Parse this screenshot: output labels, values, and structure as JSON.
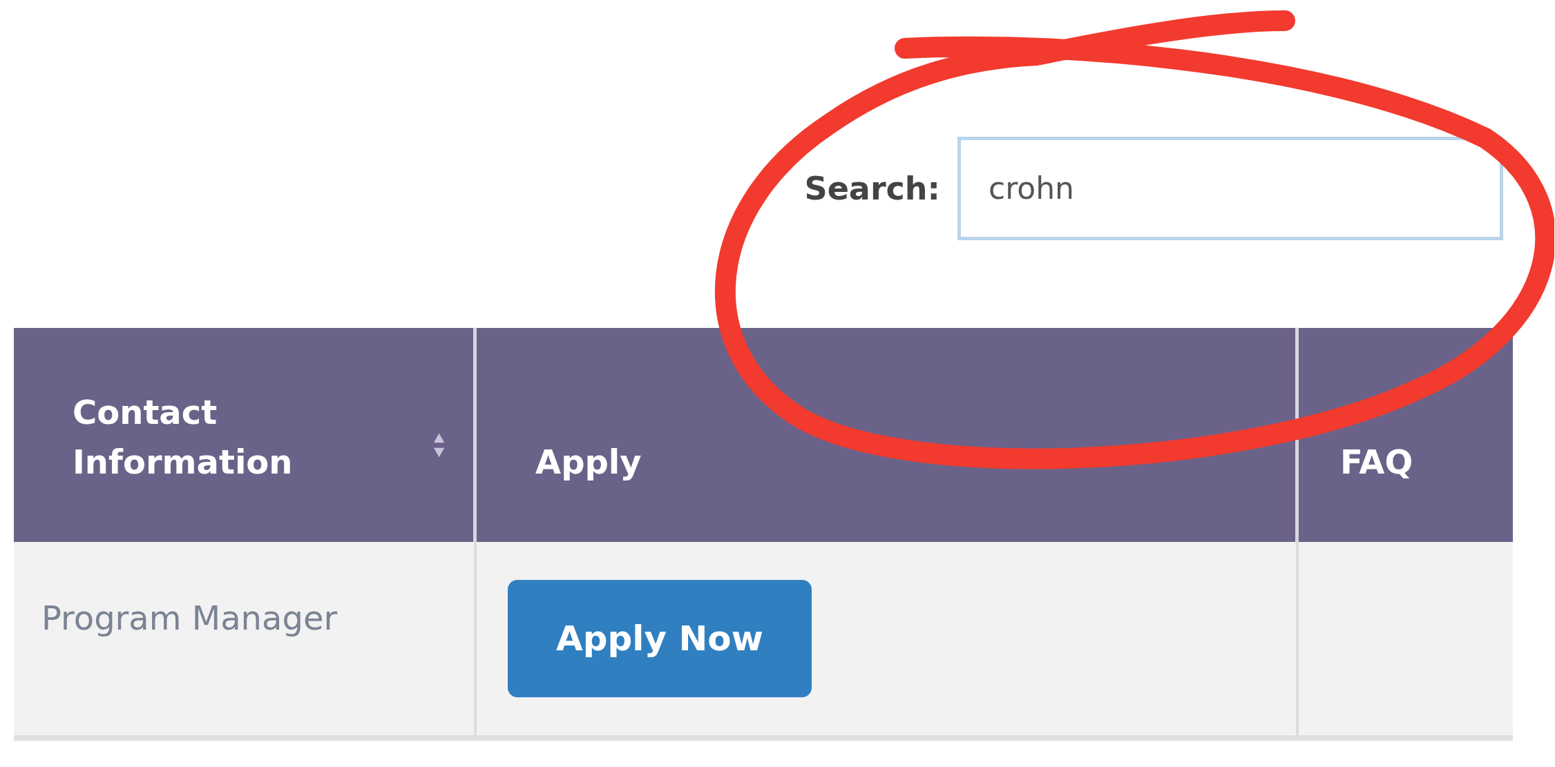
{
  "search": {
    "label": "Search:",
    "value": "crohn"
  },
  "table": {
    "columns": [
      {
        "label": "Contact Information",
        "sortable": true
      },
      {
        "label": "Apply",
        "sortable": false
      },
      {
        "label": "FAQ",
        "sortable": false
      }
    ],
    "rows": [
      {
        "contact": "Program Manager",
        "apply_button": "Apply Now"
      }
    ]
  }
}
